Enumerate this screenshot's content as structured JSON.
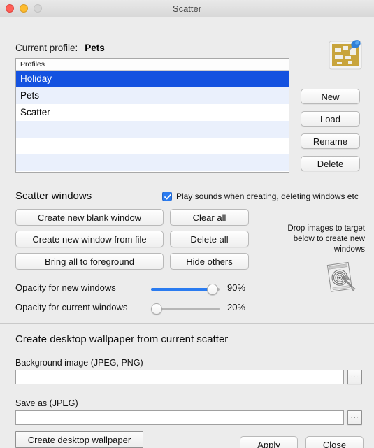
{
  "window": {
    "title": "Scatter",
    "traffic_lights": [
      "close-red",
      "minimize-yellow",
      "zoom-disabled"
    ]
  },
  "profile": {
    "label": "Current profile:",
    "value": "Pets",
    "app_icon": "corkboard-pin-icon"
  },
  "profiles_list": {
    "header": "Profiles",
    "rows": [
      {
        "name": "Holiday",
        "selected": true
      },
      {
        "name": "Pets",
        "selected": false
      },
      {
        "name": "Scatter",
        "selected": false
      },
      {
        "name": "",
        "selected": false
      },
      {
        "name": "",
        "selected": false
      },
      {
        "name": "",
        "selected": false
      }
    ],
    "buttons": [
      {
        "label": "New"
      },
      {
        "label": "Load"
      },
      {
        "label": "Rename"
      },
      {
        "label": "Delete"
      }
    ]
  },
  "scatter_windows": {
    "title": "Scatter windows",
    "sound_checkbox": {
      "label": "Play sounds when creating, deleting windows etc",
      "checked": true
    },
    "left_buttons": [
      {
        "label": "Create new blank window"
      },
      {
        "label": "Create new window from file"
      },
      {
        "label": "Bring all to foreground"
      }
    ],
    "right_buttons": [
      {
        "label": "Clear all"
      },
      {
        "label": "Delete all"
      },
      {
        "label": "Hide others"
      }
    ],
    "drop_text": "Drop images to target below to create new windows",
    "drop_icon": "target-bullseye-icon",
    "sliders": [
      {
        "label": "Opacity for new windows",
        "value": "90%",
        "percent": 90,
        "active": true
      },
      {
        "label": "Opacity for current windows",
        "value": "20%",
        "percent": 20,
        "active": false
      }
    ]
  },
  "wallpaper": {
    "title": "Create desktop wallpaper from current scatter",
    "background_label": "Background image (JPEG, PNG)",
    "background_value": "",
    "background_placeholder": "",
    "save_label": "Save as (JPEG)",
    "save_value": "",
    "save_placeholder": "",
    "browse_label": "...",
    "create_button": "Create desktop wallpaper"
  },
  "footer": {
    "apply": "Apply",
    "close": "Close"
  },
  "colors": {
    "accent_blue": "#1452e0",
    "slider_blue": "#2a7bf0",
    "window_bg": "#ececec",
    "alt_row": "#eaf0fc"
  }
}
